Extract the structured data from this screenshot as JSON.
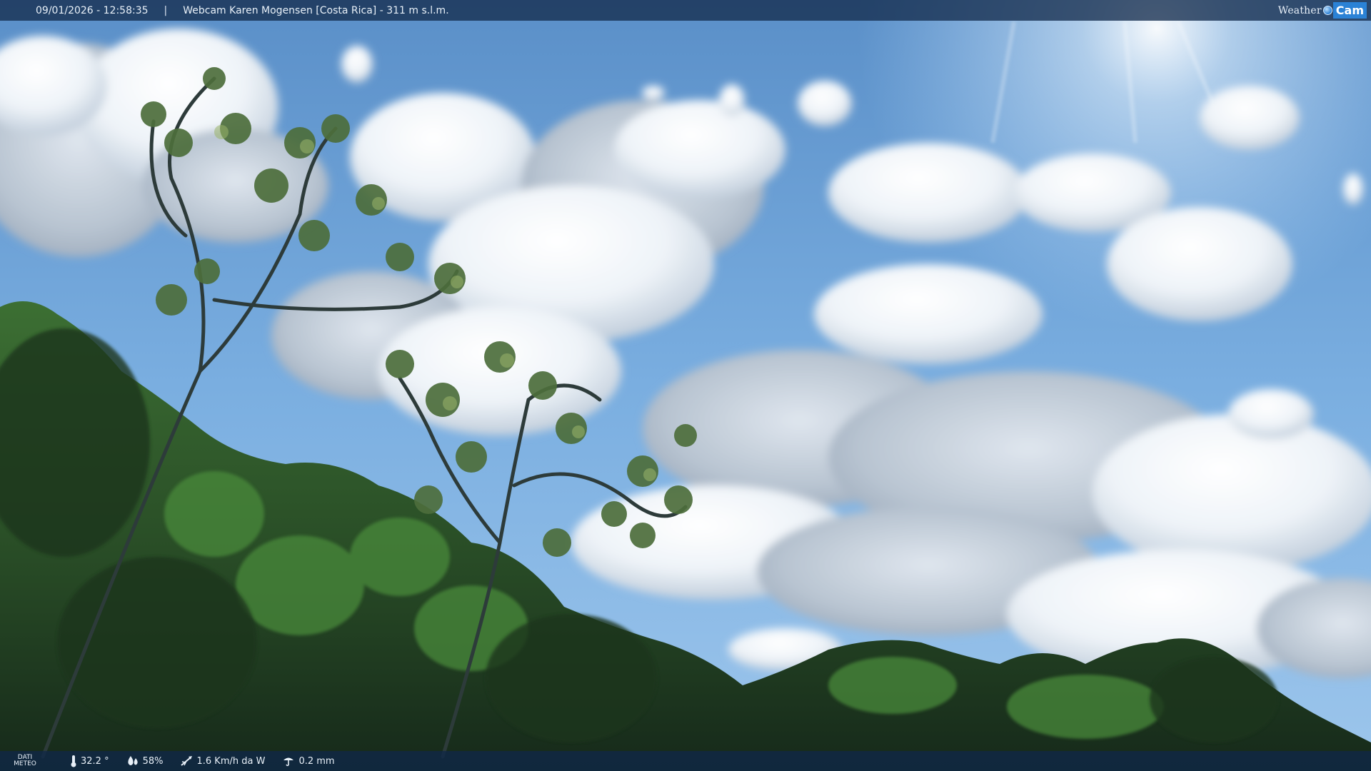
{
  "overlay": {
    "datetime": "09/01/2026 - 12:58:35",
    "separator": "|",
    "camera_title": "Webcam Karen Mogensen [Costa Rica] - 311 m s.l.m.",
    "brand": {
      "weather": "Weather",
      "cam": "Cam"
    }
  },
  "weather": {
    "label_line1": "DATI",
    "label_line2": "METEO",
    "temperature": "32.2 °",
    "humidity": "58%",
    "wind": "1.6 Km/h da W",
    "rain": "0.2 mm"
  },
  "scene": {
    "sky_colors": [
      "#7fb0df",
      "#5c8fc6",
      "#9ec9ef"
    ],
    "foliage_colors": [
      "#1f3b22",
      "#2e5a2c",
      "#3f7a34",
      "#5f9a3f"
    ]
  }
}
